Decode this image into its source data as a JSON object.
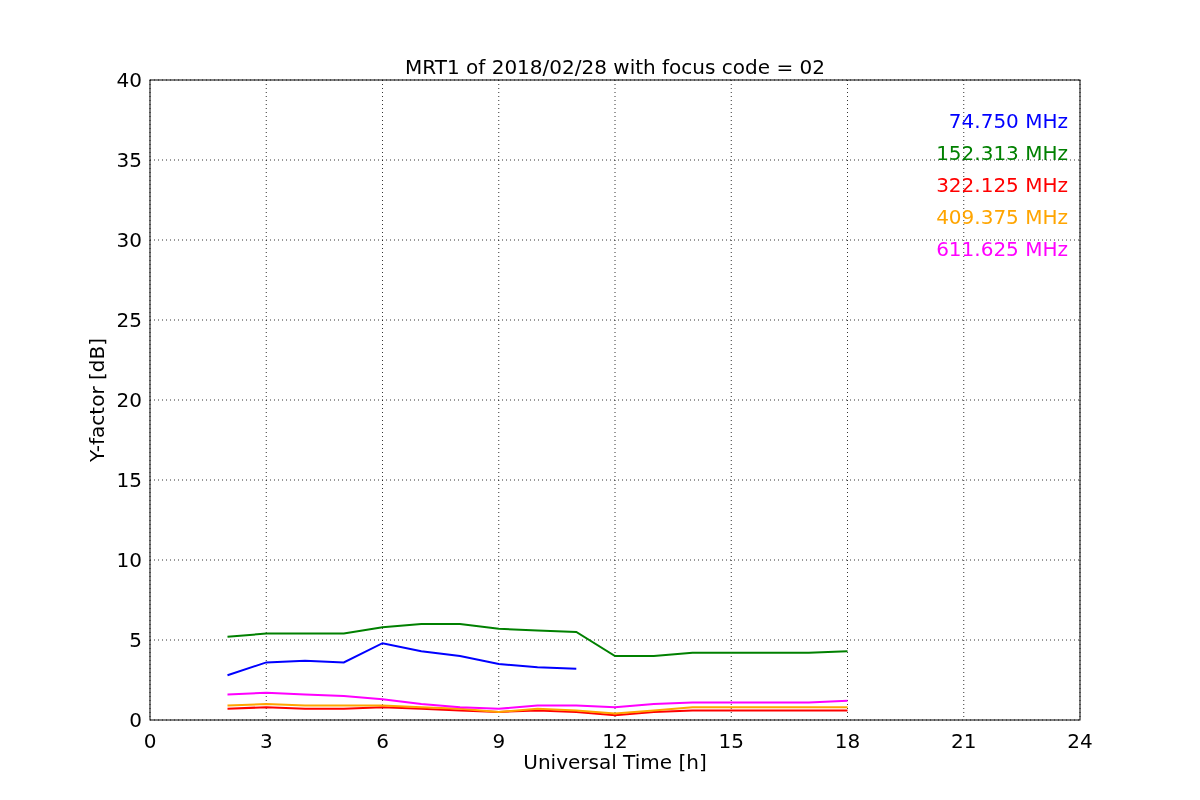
{
  "figure": {
    "chart_data": {
      "type": "line",
      "title": "MRT1 of 2018/02/28 with focus code = 02",
      "xlabel": "Universal Time [h]",
      "ylabel": "Y-factor [dB]",
      "x": [
        2,
        3,
        4,
        5,
        6,
        7,
        8,
        9,
        10,
        11,
        12,
        13,
        14,
        15,
        16,
        17,
        18
      ],
      "series": [
        {
          "name": "74.750 MHz",
          "color": "#0000ff",
          "values": [
            2.8,
            3.6,
            3.7,
            3.6,
            4.8,
            4.3,
            4.0,
            3.5,
            3.3,
            3.2,
            null,
            null,
            null,
            null,
            null,
            null,
            null
          ]
        },
        {
          "name": "152.313 MHz",
          "color": "#008000",
          "values": [
            5.2,
            5.4,
            5.4,
            5.4,
            5.8,
            6.0,
            6.0,
            5.7,
            5.6,
            5.5,
            4.0,
            4.0,
            4.2,
            4.2,
            4.2,
            4.2,
            4.3
          ]
        },
        {
          "name": "322.125 MHz",
          "color": "#ff0000",
          "values": [
            0.7,
            0.8,
            0.7,
            0.7,
            0.8,
            0.7,
            0.6,
            0.5,
            0.6,
            0.5,
            0.3,
            0.5,
            0.6,
            0.6,
            0.6,
            0.6,
            0.6
          ]
        },
        {
          "name": "409.375 MHz",
          "color": "#ffa500",
          "values": [
            0.9,
            1.0,
            0.9,
            0.9,
            0.9,
            0.8,
            0.7,
            0.5,
            0.7,
            0.6,
            0.4,
            0.6,
            0.8,
            0.8,
            0.8,
            0.8,
            0.8
          ]
        },
        {
          "name": "611.625 MHz",
          "color": "#ff00ff",
          "values": [
            1.6,
            1.7,
            1.6,
            1.5,
            1.3,
            1.0,
            0.8,
            0.7,
            0.9,
            0.9,
            0.8,
            1.0,
            1.1,
            1.1,
            1.1,
            1.1,
            1.2
          ]
        }
      ],
      "xlim": [
        0,
        24
      ],
      "ylim": [
        0,
        40
      ],
      "xticks": [
        0,
        3,
        6,
        9,
        12,
        15,
        18,
        21,
        24
      ],
      "yticks": [
        0,
        5,
        10,
        15,
        20,
        25,
        30,
        35,
        40
      ],
      "grid": true
    }
  }
}
